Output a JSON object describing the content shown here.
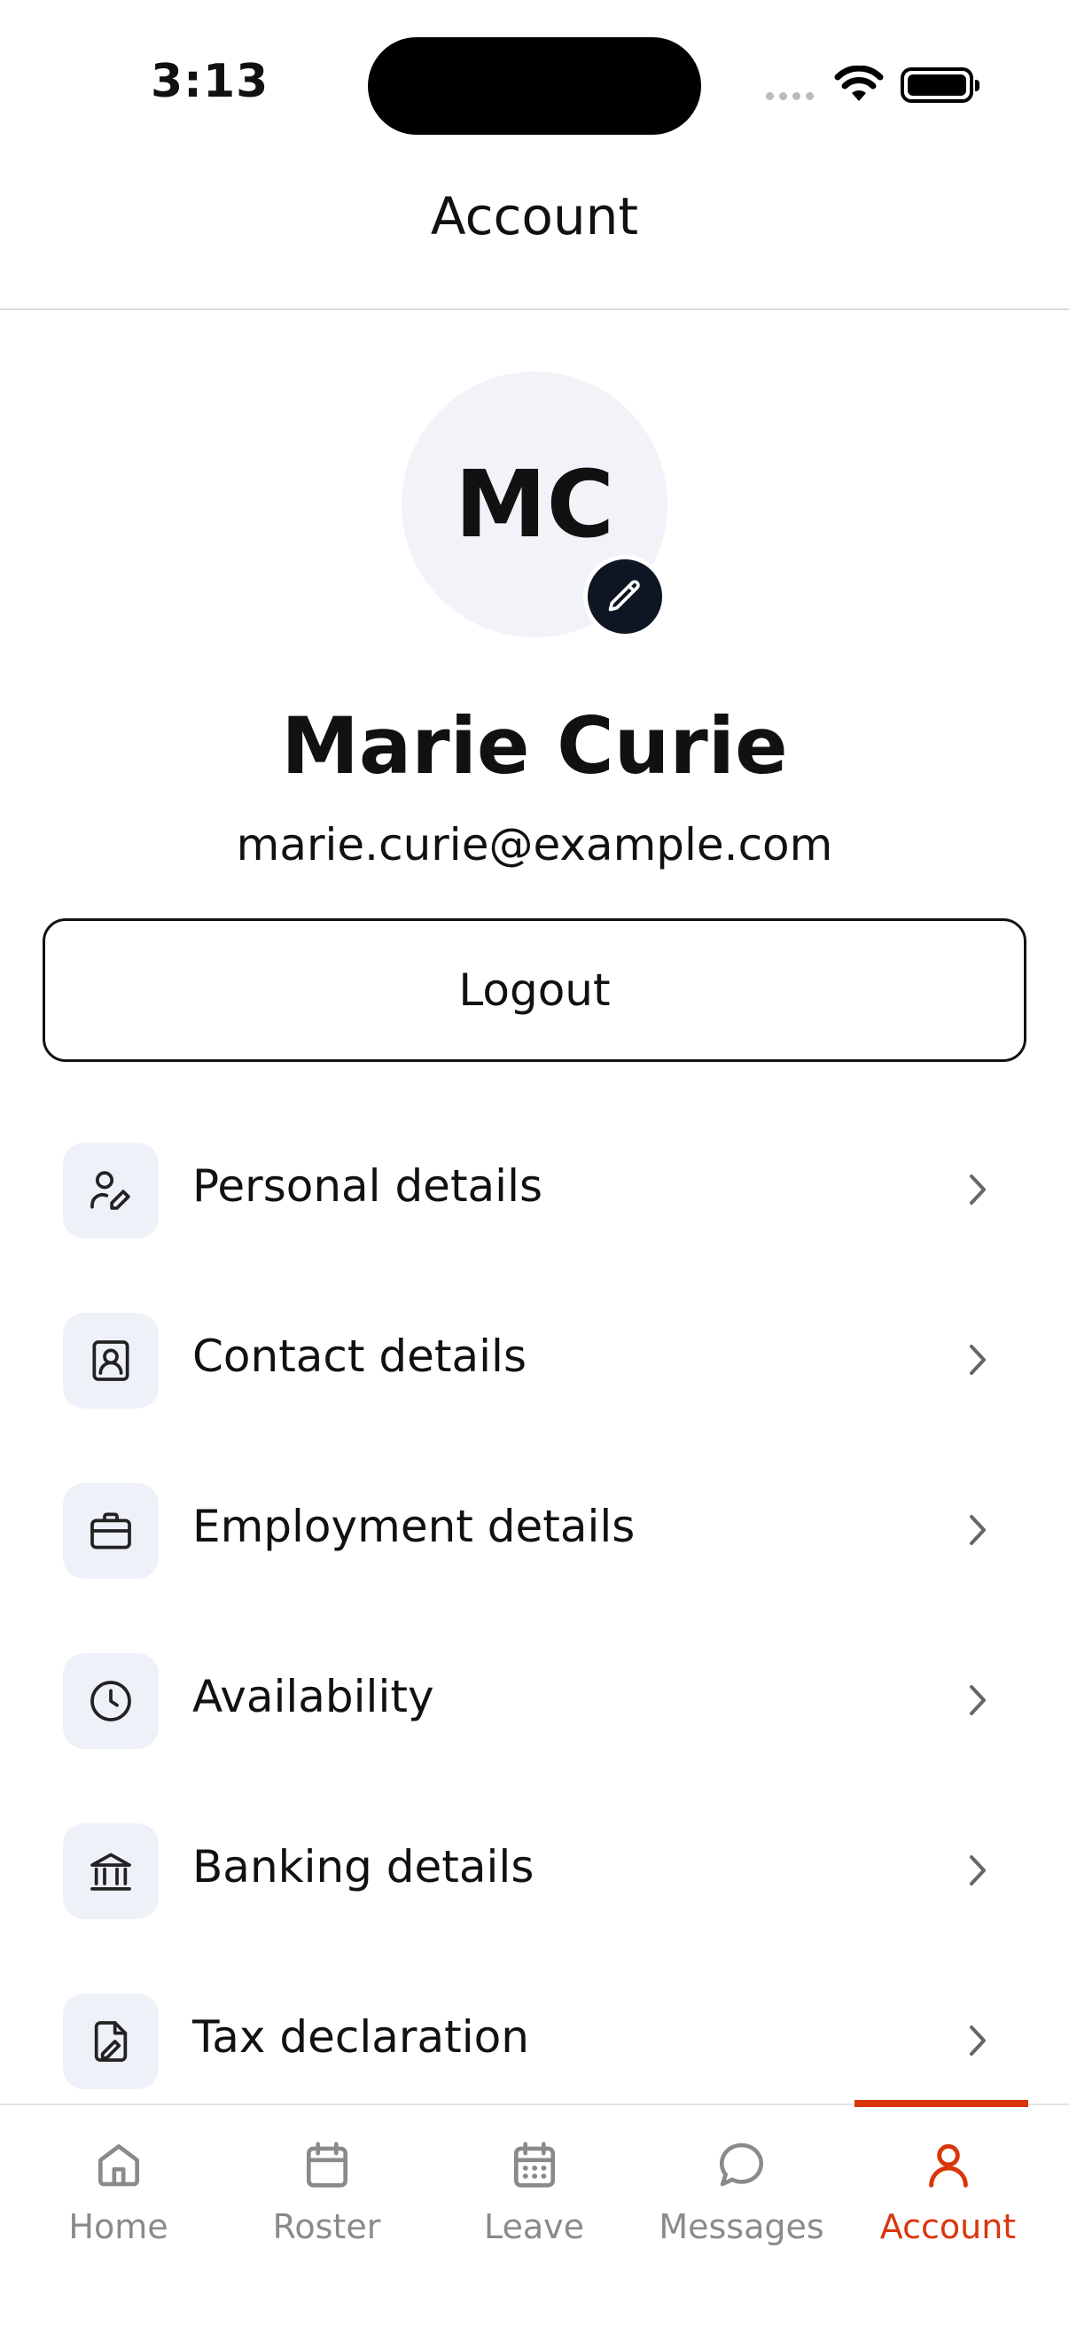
{
  "status_bar": {
    "time": "3:13"
  },
  "header": {
    "title": "Account"
  },
  "profile": {
    "initials": "MC",
    "name": "Marie Curie",
    "email": "marie.curie@example.com"
  },
  "logout_label": "Logout",
  "menu": [
    {
      "label": "Personal details",
      "icon": "user-edit-icon"
    },
    {
      "label": "Contact details",
      "icon": "contact-card-icon"
    },
    {
      "label": "Employment details",
      "icon": "briefcase-icon"
    },
    {
      "label": "Availability",
      "icon": "clock-icon"
    },
    {
      "label": "Banking details",
      "icon": "bank-icon"
    },
    {
      "label": "Tax declaration",
      "icon": "document-sign-icon"
    }
  ],
  "tabs": [
    {
      "label": "Home",
      "icon": "home-icon",
      "active": false
    },
    {
      "label": "Roster",
      "icon": "calendar-icon",
      "active": false
    },
    {
      "label": "Leave",
      "icon": "calendar-grid-icon",
      "active": false
    },
    {
      "label": "Messages",
      "icon": "chat-bubble-icon",
      "active": false
    },
    {
      "label": "Account",
      "icon": "user-icon",
      "active": true
    }
  ],
  "colors": {
    "accent": "#d9360b",
    "icon_tile": "#eef1f8",
    "avatar_bg": "#f1f3f8",
    "inactive_tab": "#8a8a8a"
  }
}
